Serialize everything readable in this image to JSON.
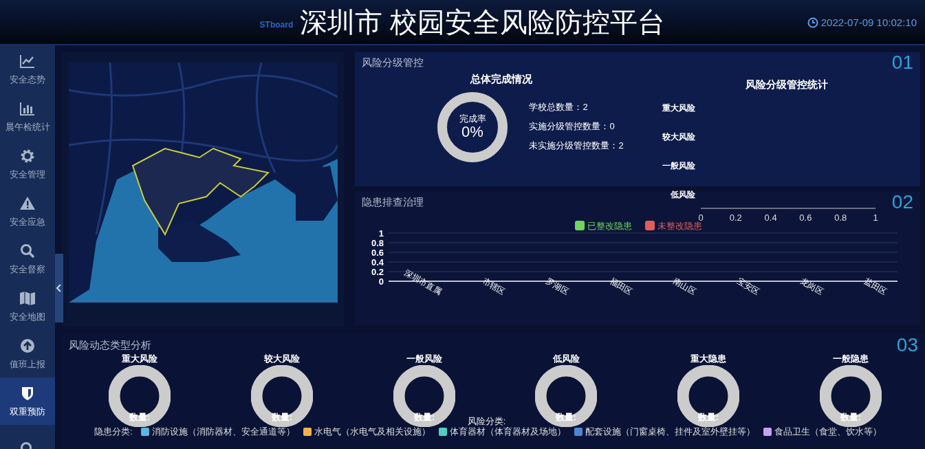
{
  "header": {
    "logo": "STboard",
    "title": "深圳市 校园安全风险防控平台",
    "datetime": "2022-07-09 10:02:10"
  },
  "sidebar": {
    "items": [
      {
        "kind": "trend",
        "label": "安全态势",
        "selected": false
      },
      {
        "kind": "bars",
        "label": "晨午检统计",
        "selected": false
      },
      {
        "kind": "gear",
        "label": "安全管理",
        "selected": false
      },
      {
        "kind": "warning",
        "label": "安全应急",
        "selected": false
      },
      {
        "kind": "search",
        "label": "安全督察",
        "selected": false
      },
      {
        "kind": "map",
        "label": "安全地图",
        "selected": false
      },
      {
        "kind": "upload",
        "label": "值班上报",
        "selected": false
      },
      {
        "kind": "shield",
        "label": "双重预防",
        "selected": true
      },
      {
        "kind": "search",
        "selected": false
      }
    ]
  },
  "risk_control": {
    "title": "风险分级管控",
    "number": "01",
    "completion": {
      "title": "总体完成情况",
      "label": "完成率",
      "value": "0%"
    },
    "stats": [
      "学校总数量：2",
      "实施分级管控数量：0",
      "未实施分级管控数量：2"
    ],
    "chart_data": {
      "type": "bar",
      "orientation": "horizontal",
      "title": "风险分级管控统计",
      "categories": [
        "重大风险",
        "较大风险",
        "一般风险",
        "低风险"
      ],
      "values": [
        0,
        0,
        0,
        0
      ],
      "xlim": [
        0,
        1
      ],
      "xticks": [
        0,
        0.2,
        0.4,
        0.6,
        0.8,
        1
      ]
    }
  },
  "hazard": {
    "title": "隐患排查治理",
    "number": "02",
    "chart_data": {
      "type": "bar",
      "categories": [
        "深圳市直属",
        "市辖区",
        "罗湖区",
        "福田区",
        "南山区",
        "宝安区",
        "龙岗区",
        "盐田区"
      ],
      "series": [
        {
          "name": "已整改隐患",
          "color": "#6cd660",
          "values": [
            0,
            0,
            0,
            0,
            0,
            0,
            0,
            0
          ]
        },
        {
          "name": "未整改隐患",
          "color": "#e25c5c",
          "values": [
            0,
            0,
            0,
            0,
            0,
            0,
            0,
            0
          ]
        }
      ],
      "grid": true,
      "ylim": [
        0,
        1
      ],
      "yticks": [
        0,
        0.2,
        0.4,
        0.6,
        0.8,
        1
      ]
    }
  },
  "dynamic": {
    "title": "风险动态类型分析",
    "number": "03",
    "donuts": [
      {
        "title": "重大风险",
        "label": "数量:"
      },
      {
        "title": "较大风险",
        "label": "数量:"
      },
      {
        "title": "一般风险",
        "label": "数量:"
      },
      {
        "title": "低风险",
        "label": "数量:"
      },
      {
        "title": "重大隐患",
        "label": "数量:"
      },
      {
        "title": "一般隐患",
        "label": "数量:"
      }
    ],
    "risk_legend_title": "风险分类:",
    "hazard_legend_title": "隐患分类:",
    "hazard_legend": [
      {
        "label": "消防设施（消防器材、安全通道等）",
        "color": "#5bb6e2"
      },
      {
        "label": "水电气（水电气及相关设施）",
        "color": "#f1b24e"
      },
      {
        "label": "体育器材（体育器材及场地）",
        "color": "#4fcfc0"
      },
      {
        "label": "配套设施（门窗桌椅、挂件及室外壁挂等）",
        "color": "#4a86d8"
      },
      {
        "label": "食品卫生（食堂、饮水等）",
        "color": "#c8a2ea"
      }
    ]
  }
}
